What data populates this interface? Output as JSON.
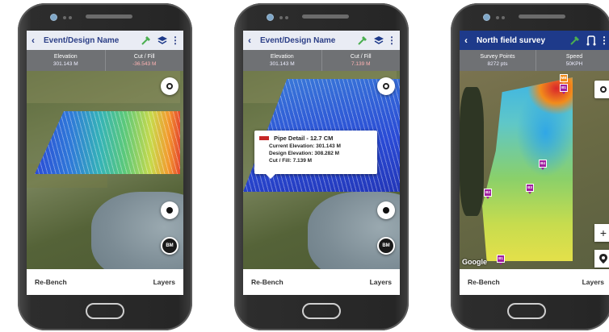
{
  "phones": [
    {
      "header": {
        "title": "Event/Design Name",
        "back_icon": "chevron-left-icon",
        "icons": [
          "survey-pole-icon",
          "layers-stack-icon",
          "more-vert-icon"
        ]
      },
      "stats": [
        {
          "label": "Elevation",
          "value": "301.143 M"
        },
        {
          "label": "Cut / Fill",
          "value": "-36.543 M"
        }
      ],
      "map_buttons": {
        "locate": "gps-locate-icon",
        "record": "record-icon",
        "bm_label": "BM"
      },
      "bottom": {
        "left": "Re-Bench",
        "right": "Layers"
      }
    },
    {
      "header": {
        "title": "Event/Design Name",
        "back_icon": "chevron-left-icon",
        "icons": [
          "survey-pole-icon",
          "layers-stack-icon",
          "more-vert-icon"
        ]
      },
      "stats": [
        {
          "label": "Elevation",
          "value": "301.143 M"
        },
        {
          "label": "Cut / Fill",
          "value": "7.139 M"
        }
      ],
      "popup": {
        "title": "Pipe Detail - 12.7 CM",
        "current_elevation": "Current Elevation: 301.143 M",
        "design_elevation": "Design Elevation: 308.282 M",
        "cut_fill": "Cut / Fill: 7.139 M",
        "pipe_color": "#c62828"
      },
      "map_buttons": {
        "locate": "gps-locate-icon",
        "record": "record-icon",
        "bm_label": "BM"
      },
      "bottom": {
        "left": "Re-Bench",
        "right": "Layers"
      }
    },
    {
      "header": {
        "title": "North field survey",
        "back_icon": "chevron-left-icon",
        "icons": [
          "survey-pole-icon",
          "route-icon",
          "more-vert-icon"
        ]
      },
      "stats": [
        {
          "label": "Survey Points",
          "value": "8272 pts"
        },
        {
          "label": "Speed",
          "value": "50KPH"
        }
      ],
      "pins": [
        "MB",
        "B1",
        "B2",
        "B3",
        "B4",
        "B1"
      ],
      "map_buttons": {
        "locate": "gps-locate-icon",
        "zoom_in": "+",
        "place": "map-pin-icon"
      },
      "map_attribution": "Google",
      "bottom": {
        "left": "Re-Bench",
        "right": "Layers"
      }
    }
  ],
  "colors": {
    "appbar_light": "#e9ecf4",
    "appbar_dark": "#1e3a8a",
    "stats_bar": "#6f7174",
    "title_blue": "#2c3f87",
    "pin_purple": "#a01fa0",
    "pin_orange": "#f28c1b"
  }
}
